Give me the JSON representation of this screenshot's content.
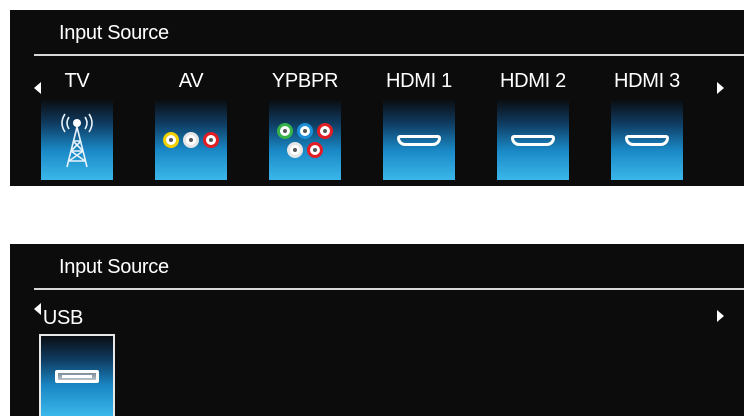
{
  "menu1": {
    "title": "Input Source",
    "items": [
      {
        "label": "TV",
        "icon": "antenna-tower-icon"
      },
      {
        "label": "AV",
        "icon": "composite-av-jacks-icon"
      },
      {
        "label": "YPBPR",
        "icon": "component-ypbpr-jacks-icon"
      },
      {
        "label": "HDMI 1",
        "icon": "hdmi-port-icon"
      },
      {
        "label": "HDMI 2",
        "icon": "hdmi-port-icon"
      },
      {
        "label": "HDMI 3",
        "icon": "hdmi-port-icon"
      }
    ]
  },
  "menu2": {
    "title": "Input Source",
    "items": [
      {
        "label": "USB",
        "icon": "usb-port-icon",
        "selected": true
      }
    ]
  },
  "colors": {
    "background": "#0c0c0c",
    "tile_gradient_bottom": "#3ab7ea",
    "jack_yellow": "#f3d000",
    "jack_red": "#e21d24",
    "jack_green": "#37b34a",
    "jack_blue": "#1d8fd8"
  }
}
